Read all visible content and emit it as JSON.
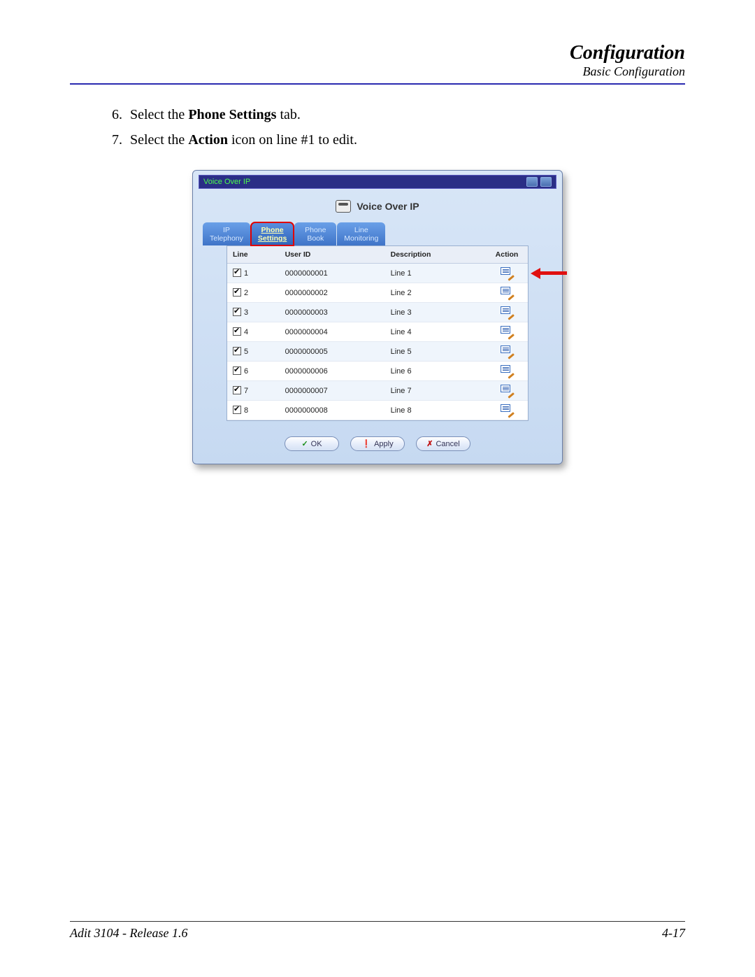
{
  "header": {
    "chapter": "Configuration",
    "section": "Basic Configuration"
  },
  "steps": [
    {
      "n": "6.",
      "pre": "Select the ",
      "bold": "Phone Settings",
      "post": " tab."
    },
    {
      "n": "7.",
      "pre": "Select the ",
      "bold": "Action",
      "post": " icon on line #1 to edit."
    }
  ],
  "window": {
    "breadcrumb": "Voice Over IP",
    "panel_title": "Voice Over IP",
    "tabs": [
      {
        "line1": "IP",
        "line2": "Telephony",
        "active": false
      },
      {
        "line1": "Phone",
        "line2": "Settings",
        "active": true
      },
      {
        "line1": "Phone",
        "line2": "Book",
        "active": false
      },
      {
        "line1": "Line",
        "line2": "Monitoring",
        "active": false
      }
    ],
    "columns": {
      "line": "Line",
      "user_id": "User ID",
      "description": "Description",
      "action": "Action"
    },
    "rows": [
      {
        "line": "1",
        "user_id": "0000000001",
        "description": "Line 1",
        "arrow": true
      },
      {
        "line": "2",
        "user_id": "0000000002",
        "description": "Line 2",
        "arrow": false
      },
      {
        "line": "3",
        "user_id": "0000000003",
        "description": "Line 3",
        "arrow": false
      },
      {
        "line": "4",
        "user_id": "0000000004",
        "description": "Line 4",
        "arrow": false
      },
      {
        "line": "5",
        "user_id": "0000000005",
        "description": "Line 5",
        "arrow": false
      },
      {
        "line": "6",
        "user_id": "0000000006",
        "description": "Line 6",
        "arrow": false
      },
      {
        "line": "7",
        "user_id": "0000000007",
        "description": "Line 7",
        "arrow": false
      },
      {
        "line": "8",
        "user_id": "0000000008",
        "description": "Line 8",
        "arrow": false
      }
    ],
    "buttons": {
      "ok": "OK",
      "apply": "Apply",
      "cancel": "Cancel"
    }
  },
  "footer": {
    "left": "Adit 3104 - Release 1.6",
    "right": "4-17"
  }
}
